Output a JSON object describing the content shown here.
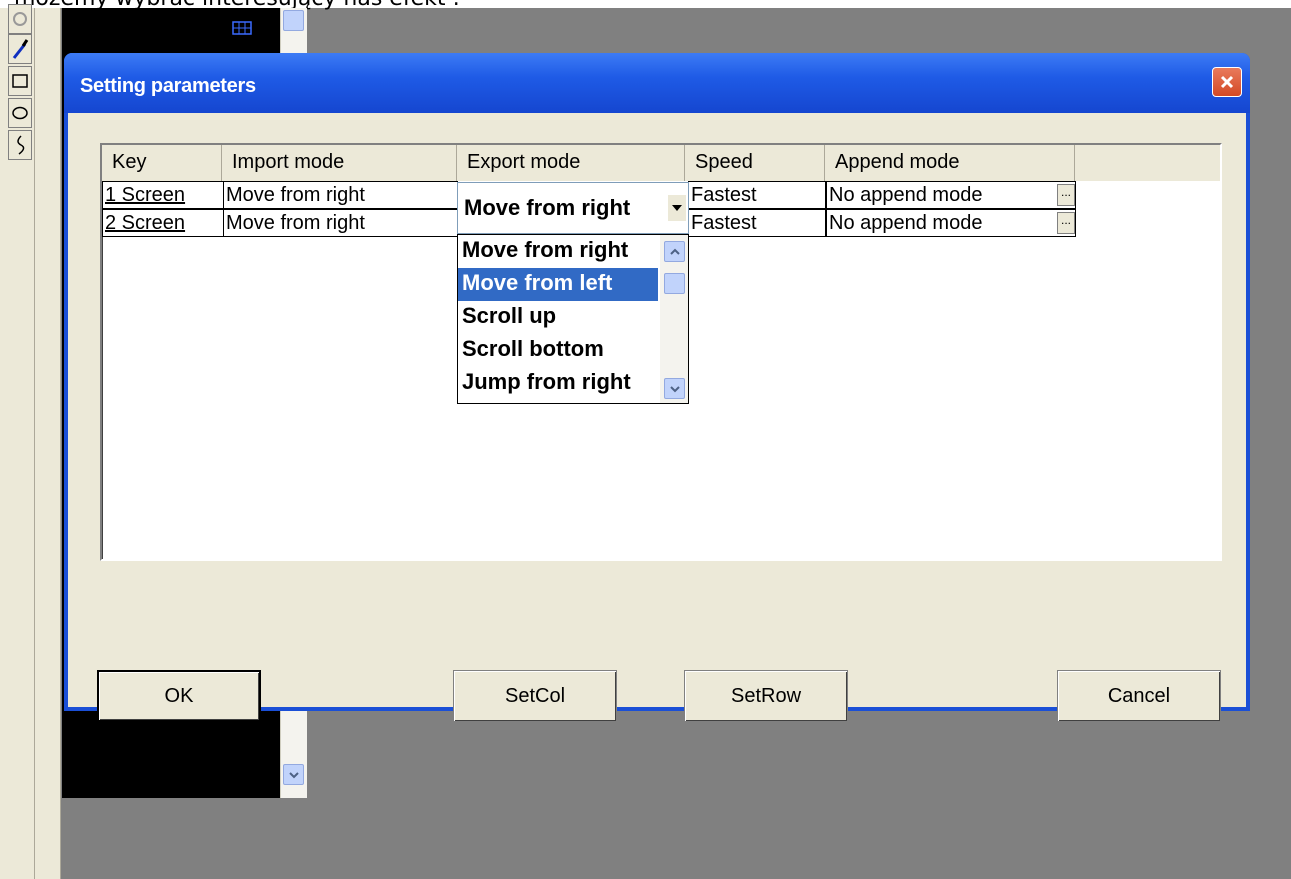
{
  "caption": "możemy wybrać interesujący nas efekt :",
  "dialog": {
    "title": "Setting parameters",
    "close_label": "X",
    "columns": [
      "Key",
      "Import mode",
      "Export mode",
      "Speed",
      "Append mode"
    ],
    "rows": [
      {
        "key": "1 Screen",
        "import_mode": "Move from right",
        "export_mode": "Move from right",
        "speed": "Fastest",
        "append_mode": "No append mode"
      },
      {
        "key": "2 Screen",
        "import_mode": "Move from right",
        "export_mode": "",
        "speed": "Fastest",
        "append_mode": "No append mode"
      }
    ],
    "combo": {
      "value": "Move from right",
      "options": [
        "Move from right",
        "Move from left",
        "Scroll up",
        "Scroll bottom",
        "Jump from right"
      ],
      "highlighted": "Move from left"
    },
    "ellipsis_label": "...",
    "buttons": {
      "ok": "OK",
      "setcol": "SetCol",
      "setrow": "SetRow",
      "cancel": "Cancel"
    }
  },
  "colors": {
    "titlebar": "#1f5be6",
    "selection": "#316ac5",
    "close": "#d34a25"
  }
}
